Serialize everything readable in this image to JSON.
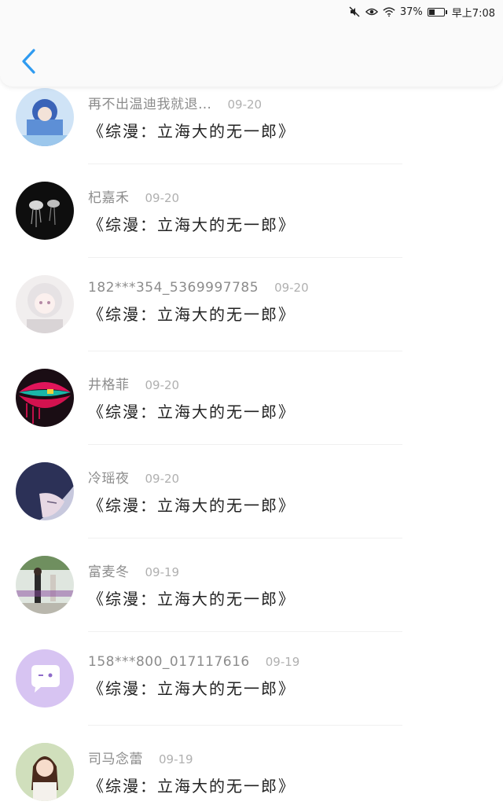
{
  "status_bar": {
    "battery_text": "37%",
    "time": "早上7:08",
    "icons": [
      "mute-icon",
      "eye-icon",
      "wifi-icon",
      "battery-icon"
    ]
  },
  "header": {
    "back_icon": "chevron-left-icon",
    "accent_color": "#2f9bf0"
  },
  "items": [
    {
      "username": "再不出温迪我就退…",
      "date": "09-20",
      "content": "《综漫：立海大的无一郎》",
      "avatar": "anime-blue-avatar"
    },
    {
      "username": "杞嘉禾",
      "date": "09-20",
      "content": "《综漫：立海大的无一郎》",
      "avatar": "dark-jellyfish-avatar"
    },
    {
      "username": "182***354_5369997785",
      "date": "09-20",
      "content": "《综漫：立海大的无一郎》",
      "avatar": "anime-white-hair-avatar"
    },
    {
      "username": "井格菲",
      "date": "09-20",
      "content": "《综漫：立海大的无一郎》",
      "avatar": "red-lips-avatar"
    },
    {
      "username": "冷瑶夜",
      "date": "09-20",
      "content": "《综漫：立海大的无一郎》",
      "avatar": "anime-dark-hair-avatar"
    },
    {
      "username": "富麦冬",
      "date": "09-19",
      "content": "《综漫：立海大的无一郎》",
      "avatar": "photo-people-avatar"
    },
    {
      "username": "158***800_017117616",
      "date": "09-19",
      "content": "《综漫：立海大的无一郎》",
      "avatar": "purple-chat-bubble-avatar"
    },
    {
      "username": "司马念蕾",
      "date": "09-19",
      "content": "《综漫：立海大的无一郎》",
      "avatar": "photo-girl-avatar"
    }
  ]
}
